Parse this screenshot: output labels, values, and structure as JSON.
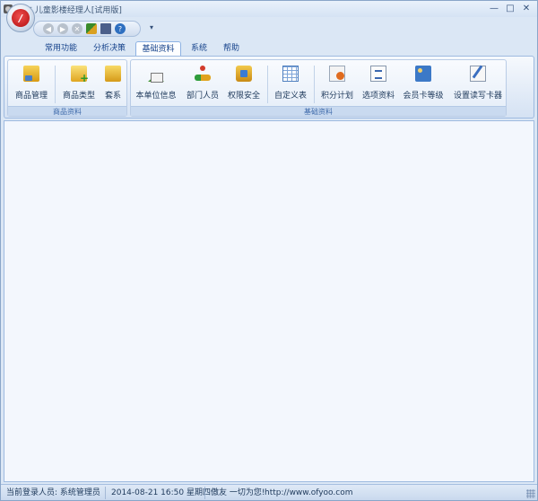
{
  "window": {
    "title": "傲友 儿童影楼经理人[试用版]",
    "controls": [
      "minimize",
      "maximize",
      "close"
    ]
  },
  "quick_access": {
    "orb_icon": "app-menu-orb-icon",
    "icons": [
      "back-icon",
      "forward-icon",
      "stop-icon",
      "tools-icon",
      "book-icon",
      "help-icon"
    ],
    "dropdown_glyph": "▾"
  },
  "tabs": [
    {
      "label": "常用功能",
      "active": false
    },
    {
      "label": "分析决策",
      "active": false
    },
    {
      "label": "基础资料",
      "active": true
    },
    {
      "label": "系统",
      "active": false
    },
    {
      "label": "帮助",
      "active": false
    }
  ],
  "ribbon": {
    "groups": [
      {
        "label": "商品资料",
        "buttons": [
          {
            "label": "商品管理",
            "icon": "goods-box-icon"
          },
          {
            "label": "商品类型",
            "icon": "goods-type-add-icon"
          },
          {
            "label": "套系",
            "icon": "package-set-icon"
          }
        ]
      },
      {
        "label": "基础资料",
        "buttons": [
          {
            "label": "本单位信息",
            "icon": "home-icon"
          },
          {
            "label": "部门人员",
            "icon": "department-people-icon"
          },
          {
            "label": "权限安全",
            "icon": "permission-lock-icon"
          },
          {
            "label": "自定义表",
            "icon": "custom-table-icon"
          },
          {
            "label": "积分计划",
            "icon": "points-plan-icon"
          },
          {
            "label": "选项资料",
            "icon": "option-list-icon"
          },
          {
            "label": "会员卡等级",
            "icon": "member-card-icon"
          },
          {
            "label": "设置读写卡器",
            "icon": "card-reader-pen-icon"
          }
        ]
      }
    ]
  },
  "statusbar": {
    "user": "当前登录人员: 系统管理员",
    "datetime": "2014-08-21 16:50 星期四",
    "slogan": "傲友 一切为您!",
    "url": "http://www.ofyoo.com"
  },
  "colors": {
    "frame": "#dbe7f5",
    "ribbon_text": "#15428b",
    "content_bg": "#f3f7fd",
    "orb_red": "#c41616"
  }
}
